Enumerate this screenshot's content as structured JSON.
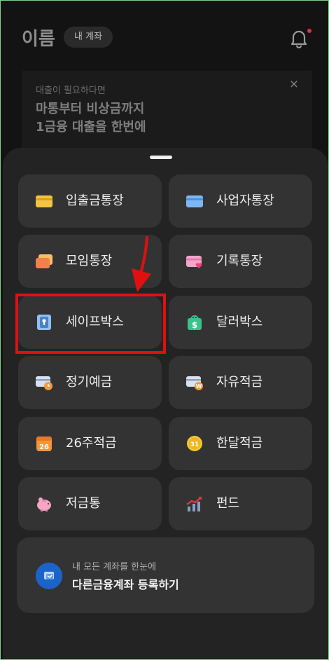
{
  "header": {
    "name": "이름",
    "account_pill": "내 계좌",
    "bell_icon": "bell-icon"
  },
  "banner": {
    "small": "대출이 필요하다면",
    "title_line1": "마통부터 비상금까지",
    "title_line2": "1금융 대출을 한번에",
    "close": "×"
  },
  "sheet": {
    "tiles": [
      {
        "label": "입출금통장",
        "icon": "yellow-card-icon"
      },
      {
        "label": "사업자통장",
        "icon": "blue-card-icon"
      },
      {
        "label": "모임통장",
        "icon": "orange-cards-icon"
      },
      {
        "label": "기록통장",
        "icon": "pink-card-heart-icon"
      },
      {
        "label": "세이프박스",
        "icon": "safe-lock-icon"
      },
      {
        "label": "달러박스",
        "icon": "dollar-gift-box-icon"
      },
      {
        "label": "정기예금",
        "icon": "card-clock-icon"
      },
      {
        "label": "자유적금",
        "icon": "card-coin-icon"
      },
      {
        "label": "26주적금",
        "icon": "calendar-26-icon"
      },
      {
        "label": "한달적금",
        "icon": "coin-31-icon"
      },
      {
        "label": "저금통",
        "icon": "piggy-bank-icon"
      },
      {
        "label": "펀드",
        "icon": "growth-chart-icon"
      }
    ],
    "register": {
      "sub": "내 모든 계좌를 한눈에",
      "main": "다른금융계좌 등록하기",
      "icon": "linked-accounts-icon"
    }
  },
  "colors": {
    "background": "#131313",
    "sheet": "#232323",
    "tile": "#333334",
    "highlight": "#e01010"
  }
}
